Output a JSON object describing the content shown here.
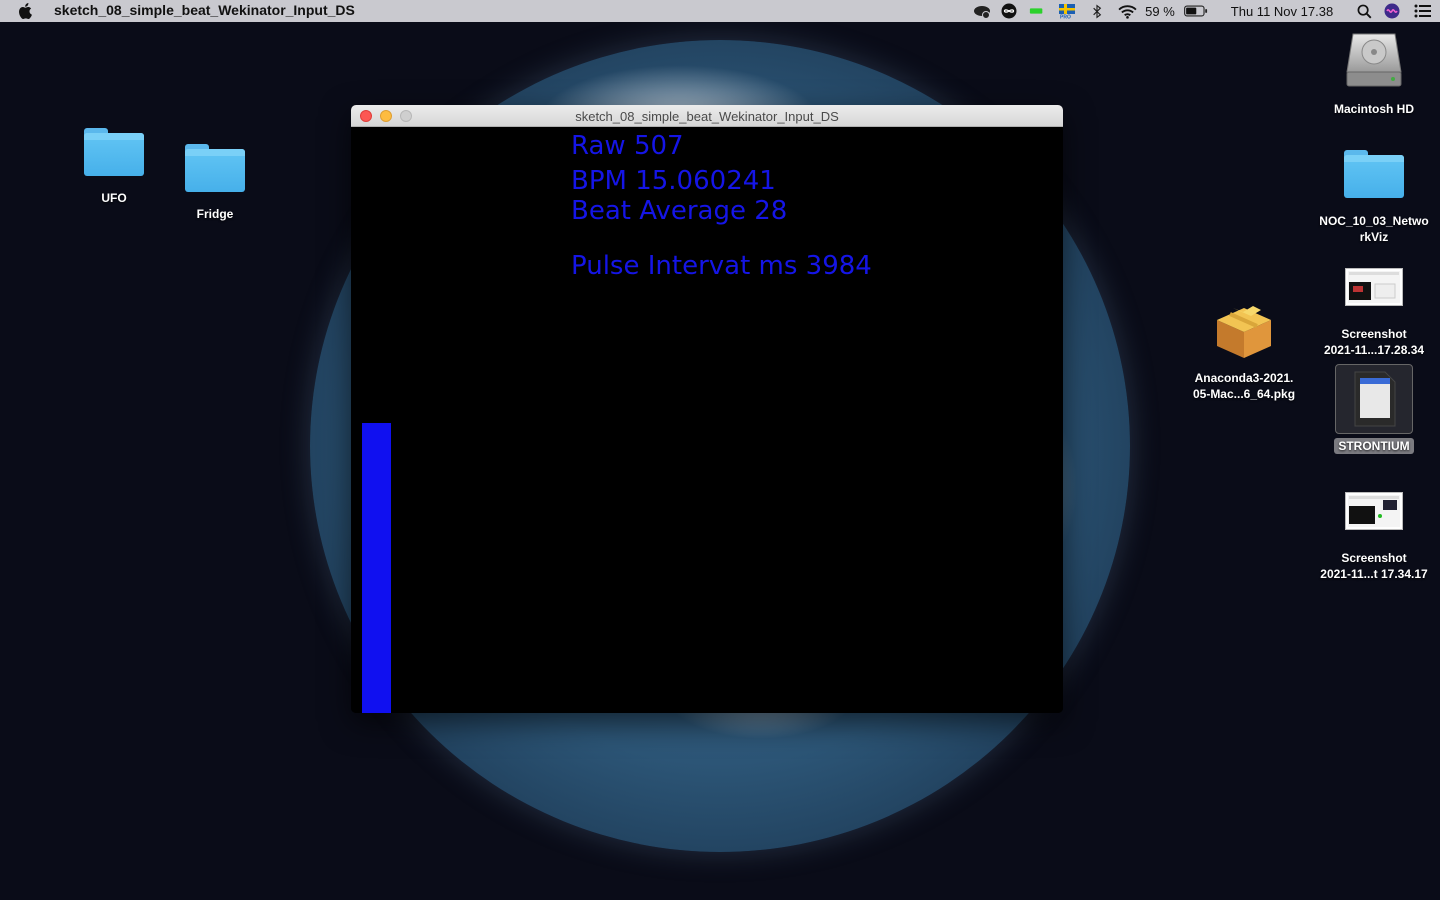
{
  "menubar": {
    "app_name": "sketch_08_simple_beat_Wekinator_Input_DS",
    "battery": "59 %",
    "datetime": "Thu 11 Nov  17.38",
    "status_icons": [
      "creative-cloud-icon",
      "infinity-icon",
      "green-battery-icon",
      "flag-sweden-icon",
      "bluetooth-icon",
      "wifi-icon",
      "battery-icon",
      "spotlight-icon",
      "siri-icon",
      "control-center-icon"
    ]
  },
  "desktop": {
    "left_icons": [
      {
        "label": "UFO",
        "icon": "folder-icon"
      },
      {
        "label": "Fridge",
        "icon": "folder-icon"
      }
    ],
    "right_icons": [
      {
        "label": "Macintosh HD",
        "icon": "hard-drive-icon"
      },
      {
        "label": "NOC_10_03_Netwo\nrkViz",
        "icon": "folder-icon"
      },
      {
        "label": "Screenshot\n2021-11...17.28.34",
        "icon": "screenshot-icon"
      },
      {
        "label": "Anaconda3-2021.\n05-Mac...6_64.pkg",
        "icon": "package-icon"
      },
      {
        "label": "STRONTIUM",
        "icon": "sd-card-icon"
      },
      {
        "label": "Screenshot\n2021-11...t 17.34.17",
        "icon": "screenshot-icon"
      }
    ]
  },
  "window": {
    "title": "sketch_08_simple_beat_Wekinator_Input_DS",
    "readouts": {
      "raw": "Raw 507",
      "bpm": "BPM 15.060241",
      "beat_average": "Beat Average 28",
      "pulse_interval": "Pulse Intervat ms 3984"
    },
    "bar_level": 0.495,
    "bar_color": "#1010f0",
    "text_color": "#1515e6"
  }
}
